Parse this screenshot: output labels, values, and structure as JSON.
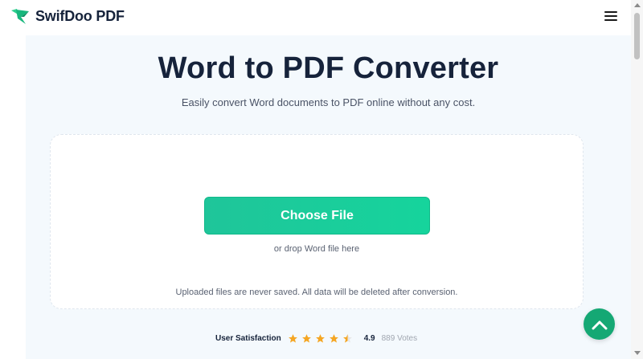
{
  "header": {
    "brand": "SwifDoo PDF",
    "logo_icon": "swallow-logo-icon",
    "menu_icon": "hamburger-menu-icon"
  },
  "hero": {
    "title": "Word to PDF Converter",
    "subtitle": "Easily convert Word documents to PDF online without any cost."
  },
  "upload": {
    "button_label": "Choose File",
    "drop_hint": "or drop Word file here",
    "privacy_note": "Uploaded files are never saved. All data will be deleted after conversion."
  },
  "rating": {
    "label": "User Satisfaction",
    "score": "4.9",
    "votes": "889 Votes",
    "stars_filled": 4.5,
    "stars_total": 5,
    "star_color": "#f5a623"
  },
  "scroll_top": {
    "icon": "chevron-up-icon",
    "color": "#15a874"
  },
  "colors": {
    "accent": "#1fc59a",
    "hero_bg": "#f4f9fd",
    "title": "#16233b"
  }
}
